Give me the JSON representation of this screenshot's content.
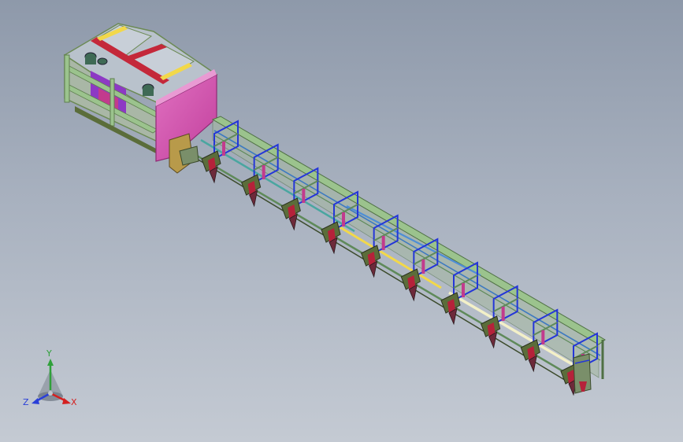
{
  "viewport": {
    "background_top": "#8e99aa",
    "background_bottom": "#c4cad3"
  },
  "model": {
    "frame_color": "#9bc38d",
    "panel_magenta": "#d95ab2",
    "panel_purple": "#8d39c4",
    "beam_red": "#c4283a",
    "beam_yellow": "#f2d84a",
    "cross_blue": "#2436d8",
    "rail_green": "#5f8a5a",
    "rail_teal": "#4aa6a0",
    "bracket_red": "#b5223a",
    "bracket_dark": "#5b6d3a",
    "station_count": 10
  },
  "triad": {
    "y_label": "Y",
    "x_label": "X",
    "z_label": "Z",
    "y_color": "#2fa03a",
    "x_color": "#d42020",
    "z_color": "#2a3fd8"
  }
}
